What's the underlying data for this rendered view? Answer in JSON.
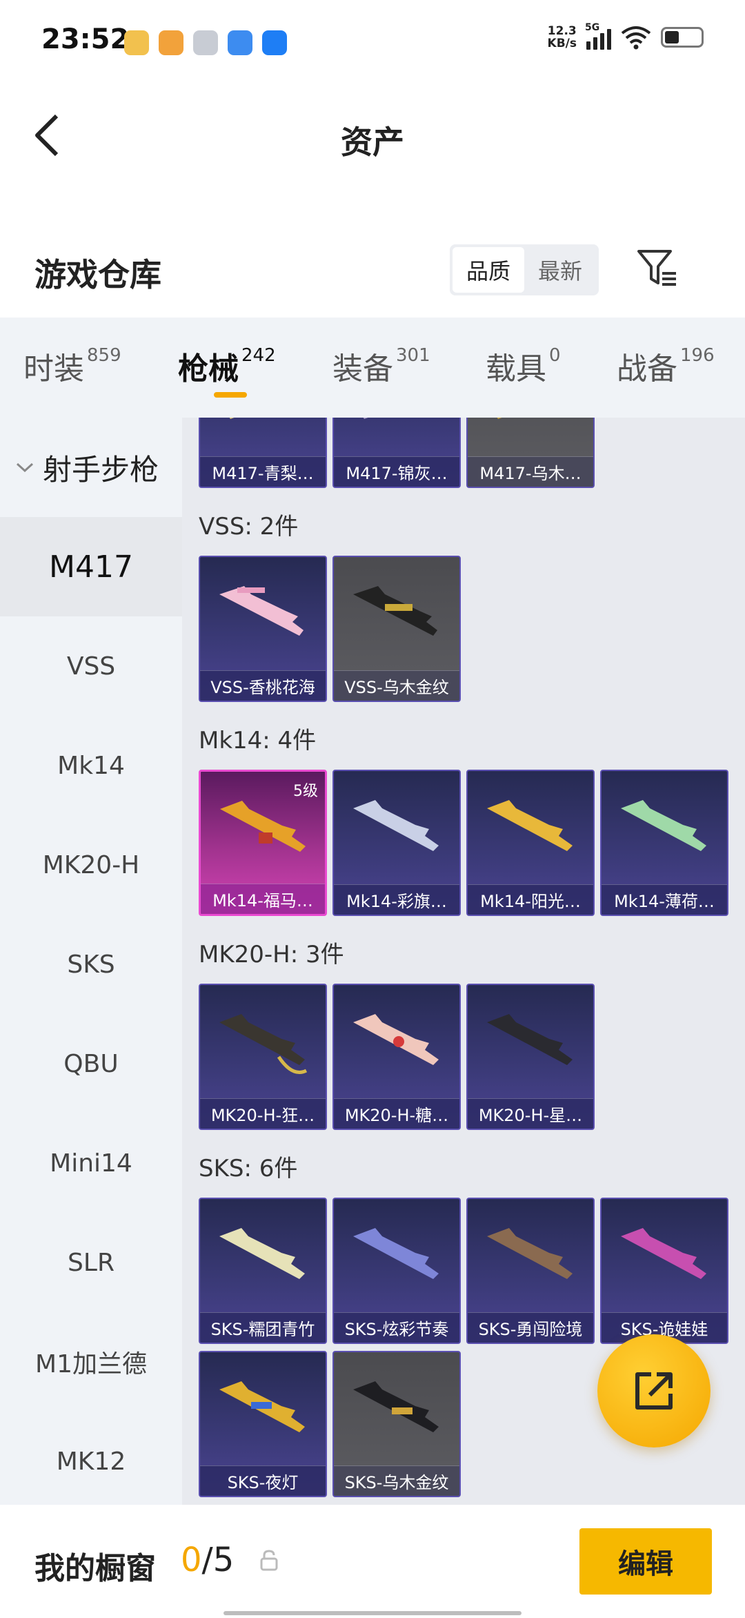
{
  "status_bar": {
    "time": "23:52",
    "net_speed_value": "12.3",
    "net_speed_unit": "KB/s",
    "network_type": "5G",
    "battery_icon": "battery-icon",
    "app_icon_colors": [
      "#f2c14e",
      "#f2a23b",
      "#c8ccd4",
      "#3d8cf0",
      "#1e7ef5"
    ]
  },
  "header": {
    "title": "资产",
    "back_icon": "back-arrow-icon"
  },
  "section": {
    "title": "游戏仓库",
    "sort_options": [
      "品质",
      "最新"
    ],
    "sort_selected": "品质",
    "filter_icon": "filter-icon"
  },
  "tabs": [
    {
      "label": "时装",
      "count": "859"
    },
    {
      "label": "枪械",
      "count": "242",
      "active": true
    },
    {
      "label": "装备",
      "count": "301"
    },
    {
      "label": "载具",
      "count": "0"
    },
    {
      "label": "战备",
      "count": "196"
    }
  ],
  "sidebar": {
    "group": "射手步枪",
    "items": [
      "M417",
      "VSS",
      "Mk14",
      "MK20-H",
      "SKS",
      "QBU",
      "Mini14",
      "SLR",
      "M1加兰德",
      "MK12"
    ],
    "selected": "M417"
  },
  "content": {
    "partial_row": [
      "M417-青梨…",
      "M417-锦灰…",
      "M417-乌木…"
    ],
    "groups": [
      {
        "heading": "VSS: 2件",
        "items": [
          "VSS-香桃花海",
          "VSS-乌木金纹"
        ]
      },
      {
        "heading": "Mk14: 4件",
        "items": [
          "Mk14-福马…",
          "Mk14-彩旗…",
          "Mk14-阳光…",
          "Mk14-薄荷…"
        ],
        "grade": "5级"
      },
      {
        "heading": "MK20-H: 3件",
        "items": [
          "MK20-H-狂…",
          "MK20-H-糖…",
          "MK20-H-星…"
        ]
      },
      {
        "heading": "SKS: 6件",
        "items": [
          "SKS-糯团青竹",
          "SKS-炫彩节奏",
          "SKS-勇闯险境",
          "SKS-诡娃娃",
          "SKS-夜灯",
          "SKS-乌木金纹"
        ]
      }
    ]
  },
  "fab": {
    "icon": "share-external-icon"
  },
  "bottom_bar": {
    "label": "我的橱窗",
    "count_current": "0",
    "count_total": "/5",
    "lock_icon": "lock-icon",
    "edit_label": "编辑"
  },
  "colors": {
    "accent": "#f5a700",
    "card_purple": "#3b3a78",
    "card_pink": "#d544b6",
    "sidebar_bg": "#f0f3f7"
  }
}
